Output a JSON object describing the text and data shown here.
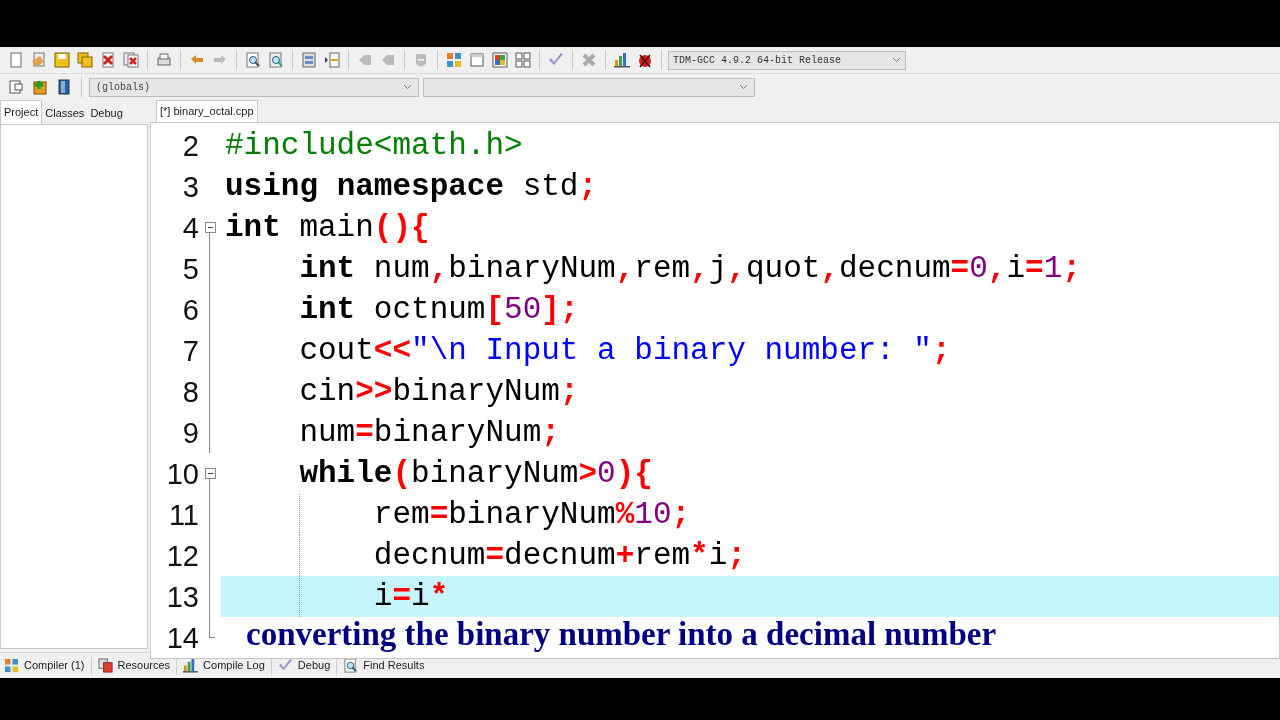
{
  "toolbar": {
    "compiler_select": "TDM-GCC 4.9.2 64-bit Release"
  },
  "scope_bar": {
    "scope_select": "(globals)"
  },
  "side_tabs": [
    {
      "label": "Project",
      "selected": true
    },
    {
      "label": "Classes",
      "selected": false
    },
    {
      "label": "Debug",
      "selected": false
    }
  ],
  "editor_tabs": [
    {
      "label": "[*] binary_octal.cpp",
      "selected": true
    }
  ],
  "editor": {
    "lines": [
      {
        "number": "2",
        "current": false,
        "tokens": [
          {
            "kind": "pre",
            "text": "#include<math.h>"
          }
        ]
      },
      {
        "number": "3",
        "current": false,
        "tokens": [
          {
            "kind": "kw",
            "text": "using "
          },
          {
            "kind": "kw",
            "text": "namespace"
          },
          {
            "kind": "id",
            "text": " std"
          },
          {
            "kind": "op",
            "text": ";"
          }
        ]
      },
      {
        "number": "4",
        "current": false,
        "fold_start": true,
        "tokens": [
          {
            "kind": "kw",
            "text": "int"
          },
          {
            "kind": "id",
            "text": " main"
          },
          {
            "kind": "op",
            "text": "(){"
          }
        ]
      },
      {
        "number": "5",
        "current": false,
        "tokens": [
          {
            "kind": "kw",
            "text": "    int"
          },
          {
            "kind": "id",
            "text": " num"
          },
          {
            "kind": "op",
            "text": ","
          },
          {
            "kind": "id",
            "text": "binaryNum"
          },
          {
            "kind": "op",
            "text": ","
          },
          {
            "kind": "id",
            "text": "rem"
          },
          {
            "kind": "op",
            "text": ","
          },
          {
            "kind": "id",
            "text": "j"
          },
          {
            "kind": "op",
            "text": ","
          },
          {
            "kind": "id",
            "text": "quot"
          },
          {
            "kind": "op",
            "text": ","
          },
          {
            "kind": "id",
            "text": "decnum"
          },
          {
            "kind": "op",
            "text": "="
          },
          {
            "kind": "num",
            "text": "0"
          },
          {
            "kind": "op",
            "text": ","
          },
          {
            "kind": "id",
            "text": "i"
          },
          {
            "kind": "op",
            "text": "="
          },
          {
            "kind": "num",
            "text": "1"
          },
          {
            "kind": "op",
            "text": ";"
          }
        ]
      },
      {
        "number": "6",
        "current": false,
        "tokens": [
          {
            "kind": "kw",
            "text": "    int"
          },
          {
            "kind": "id",
            "text": " octnum"
          },
          {
            "kind": "op",
            "text": "["
          },
          {
            "kind": "num",
            "text": "50"
          },
          {
            "kind": "op",
            "text": "];"
          }
        ]
      },
      {
        "number": "7",
        "current": false,
        "tokens": [
          {
            "kind": "id",
            "text": "    cout"
          },
          {
            "kind": "op",
            "text": "<<"
          },
          {
            "kind": "str",
            "text": "\"\\n Input a binary number: \""
          },
          {
            "kind": "op",
            "text": ";"
          }
        ]
      },
      {
        "number": "8",
        "current": false,
        "tokens": [
          {
            "kind": "id",
            "text": "    cin"
          },
          {
            "kind": "op",
            "text": ">>"
          },
          {
            "kind": "id",
            "text": "binaryNum"
          },
          {
            "kind": "op",
            "text": ";"
          }
        ]
      },
      {
        "number": "9",
        "current": false,
        "tokens": [
          {
            "kind": "id",
            "text": "    num"
          },
          {
            "kind": "op",
            "text": "="
          },
          {
            "kind": "id",
            "text": "binaryNum"
          },
          {
            "kind": "op",
            "text": ";"
          }
        ]
      },
      {
        "number": "10",
        "current": false,
        "fold_start": true,
        "tokens": [
          {
            "kind": "kw",
            "text": "    while"
          },
          {
            "kind": "op",
            "text": "("
          },
          {
            "kind": "id",
            "text": "binaryNum"
          },
          {
            "kind": "op",
            "text": ">"
          },
          {
            "kind": "num",
            "text": "0"
          },
          {
            "kind": "op",
            "text": "){"
          }
        ]
      },
      {
        "number": "11",
        "current": false,
        "tokens": [
          {
            "kind": "id",
            "text": "        rem"
          },
          {
            "kind": "op",
            "text": "="
          },
          {
            "kind": "id",
            "text": "binaryNum"
          },
          {
            "kind": "op",
            "text": "%"
          },
          {
            "kind": "num",
            "text": "10"
          },
          {
            "kind": "op",
            "text": ";"
          }
        ]
      },
      {
        "number": "12",
        "current": false,
        "tokens": [
          {
            "kind": "id",
            "text": "        decnum"
          },
          {
            "kind": "op",
            "text": "="
          },
          {
            "kind": "id",
            "text": "decnum"
          },
          {
            "kind": "op",
            "text": "+"
          },
          {
            "kind": "id",
            "text": "rem"
          },
          {
            "kind": "op",
            "text": "*"
          },
          {
            "kind": "id",
            "text": "i"
          },
          {
            "kind": "op",
            "text": ";"
          }
        ]
      },
      {
        "number": "13",
        "current": true,
        "tokens": [
          {
            "kind": "id",
            "text": "        i"
          },
          {
            "kind": "op",
            "text": "="
          },
          {
            "kind": "id",
            "text": "i"
          },
          {
            "kind": "op",
            "text": "*"
          }
        ]
      },
      {
        "number": "14",
        "current": false,
        "fold_end": true
      }
    ]
  },
  "caption": "converting the binary number into a decimal number",
  "bottom_tabs": [
    {
      "label": "Compiler (1)",
      "kind": "grid"
    },
    {
      "label": "Resources",
      "kind": "pages"
    },
    {
      "label": "Compile Log",
      "kind": "chart"
    },
    {
      "label": "Debug",
      "kind": "check"
    },
    {
      "label": "Find Results",
      "kind": "find"
    }
  ]
}
